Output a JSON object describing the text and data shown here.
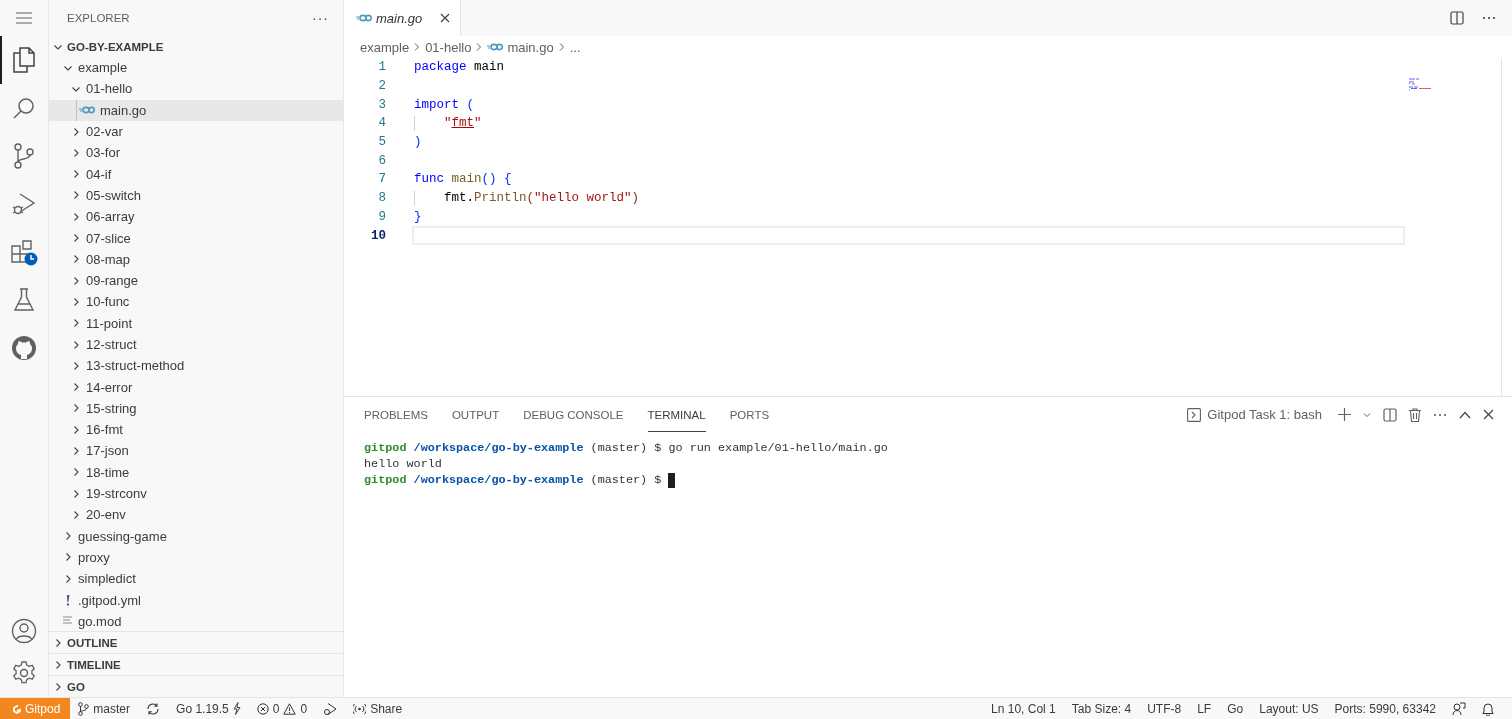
{
  "activity_bar": {
    "top": [
      {
        "kind": "menu",
        "selected": false
      },
      {
        "kind": "explorer",
        "selected": true
      },
      {
        "kind": "search",
        "selected": false
      },
      {
        "kind": "source-control",
        "selected": false
      },
      {
        "kind": "run-debug",
        "selected": false
      },
      {
        "kind": "extensions",
        "selected": false
      },
      {
        "kind": "testing",
        "selected": false
      },
      {
        "kind": "github",
        "selected": false
      }
    ],
    "bottom": [
      {
        "kind": "account"
      },
      {
        "kind": "settings"
      }
    ]
  },
  "sidebar": {
    "title": "EXPLORER",
    "more": "···",
    "root": {
      "label": "GO-BY-EXAMPLE",
      "expanded": true,
      "children": [
        {
          "label": "example",
          "kind": "folder",
          "expanded": true,
          "selected": false,
          "children": [
            {
              "label": "01-hello",
              "kind": "folder",
              "expanded": true,
              "selected": false,
              "children": [
                {
                  "label": "main.go",
                  "kind": "go",
                  "selected": true
                }
              ]
            },
            {
              "label": "02-var",
              "kind": "folder",
              "expanded": false,
              "selected": false
            },
            {
              "label": "03-for",
              "kind": "folder",
              "expanded": false,
              "selected": false
            },
            {
              "label": "04-if",
              "kind": "folder",
              "expanded": false,
              "selected": false
            },
            {
              "label": "05-switch",
              "kind": "folder",
              "expanded": false,
              "selected": false
            },
            {
              "label": "06-array",
              "kind": "folder",
              "expanded": false,
              "selected": false
            },
            {
              "label": "07-slice",
              "kind": "folder",
              "expanded": false,
              "selected": false
            },
            {
              "label": "08-map",
              "kind": "folder",
              "expanded": false,
              "selected": false
            },
            {
              "label": "09-range",
              "kind": "folder",
              "expanded": false,
              "selected": false
            },
            {
              "label": "10-func",
              "kind": "folder",
              "expanded": false,
              "selected": false
            },
            {
              "label": "11-point",
              "kind": "folder",
              "expanded": false,
              "selected": false
            },
            {
              "label": "12-struct",
              "kind": "folder",
              "expanded": false,
              "selected": false
            },
            {
              "label": "13-struct-method",
              "kind": "folder",
              "expanded": false,
              "selected": false
            },
            {
              "label": "14-error",
              "kind": "folder",
              "expanded": false,
              "selected": false
            },
            {
              "label": "15-string",
              "kind": "folder",
              "expanded": false,
              "selected": false
            },
            {
              "label": "16-fmt",
              "kind": "folder",
              "expanded": false,
              "selected": false
            },
            {
              "label": "17-json",
              "kind": "folder",
              "expanded": false,
              "selected": false
            },
            {
              "label": "18-time",
              "kind": "folder",
              "expanded": false,
              "selected": false
            },
            {
              "label": "19-strconv",
              "kind": "folder",
              "expanded": false,
              "selected": false
            },
            {
              "label": "20-env",
              "kind": "folder",
              "expanded": false,
              "selected": false
            }
          ]
        },
        {
          "label": "guessing-game",
          "kind": "folder",
          "expanded": false,
          "selected": false
        },
        {
          "label": "proxy",
          "kind": "folder",
          "expanded": false,
          "selected": false
        },
        {
          "label": "simpledict",
          "kind": "folder",
          "expanded": false,
          "selected": false
        },
        {
          "label": ".gitpod.yml",
          "kind": "yaml",
          "selected": false
        },
        {
          "label": "go.mod",
          "kind": "text",
          "selected": false
        }
      ]
    },
    "sections": [
      {
        "label": "OUTLINE",
        "expanded": false
      },
      {
        "label": "TIMELINE",
        "expanded": false
      },
      {
        "label": "GO",
        "expanded": false
      }
    ]
  },
  "editor": {
    "tabs": [
      {
        "label": "main.go",
        "preview": true,
        "selected": true
      }
    ],
    "breadcrumb": [
      "example",
      "01-hello",
      "main.go",
      "..."
    ],
    "lines": [
      {
        "number": "1",
        "current": false,
        "indented": false,
        "tokens": [
          {
            "text": "package",
            "kind": "keyword"
          },
          {
            "text": " main",
            "kind": "plain"
          }
        ]
      },
      {
        "number": "2",
        "current": false,
        "indented": false
      },
      {
        "number": "3",
        "current": false,
        "indented": false,
        "tokens": [
          {
            "text": "import",
            "kind": "keyword"
          },
          {
            "text": " (",
            "kind": "bracket1"
          }
        ]
      },
      {
        "number": "4",
        "current": false,
        "indented": true,
        "tokens": [
          {
            "text": "\"",
            "kind": "string",
            "underline": false
          },
          {
            "text": "fmt",
            "kind": "string",
            "underline": true
          },
          {
            "text": "\"",
            "kind": "string",
            "underline": false
          }
        ]
      },
      {
        "number": "5",
        "current": false,
        "indented": false,
        "tokens": [
          {
            "text": ")",
            "kind": "bracket1"
          }
        ]
      },
      {
        "number": "6",
        "current": false,
        "indented": false
      },
      {
        "number": "7",
        "current": false,
        "indented": false,
        "tokens": [
          {
            "text": "func",
            "kind": "keyword"
          },
          {
            "text": " main",
            "kind": "function"
          },
          {
            "text": "() {",
            "kind": "bracket1"
          }
        ]
      },
      {
        "number": "8",
        "current": false,
        "indented": true,
        "tokens": [
          {
            "text": "fmt.",
            "kind": "plain"
          },
          {
            "text": "Println",
            "kind": "function"
          },
          {
            "text": "(",
            "kind": "bracket2"
          },
          {
            "text": "\"hello world\"",
            "kind": "string"
          },
          {
            "text": ")",
            "kind": "bracket2"
          }
        ]
      },
      {
        "number": "9",
        "current": false,
        "indented": false,
        "tokens": [
          {
            "text": "}",
            "kind": "bracket1"
          }
        ]
      },
      {
        "number": "10",
        "current": true,
        "indented": false
      }
    ]
  },
  "panel": {
    "tabs": [
      {
        "label": "PROBLEMS",
        "selected": false
      },
      {
        "label": "OUTPUT",
        "selected": false
      },
      {
        "label": "DEBUG CONSOLE",
        "selected": false
      },
      {
        "label": "TERMINAL",
        "selected": true
      },
      {
        "label": "PORTS",
        "selected": false
      }
    ],
    "terminal_name": "Gitpod Task 1: bash",
    "terminal": [
      {
        "cursor": false,
        "segments": [
          {
            "text": "gitpod",
            "kind": "user"
          },
          {
            "text": " /workspace/go-by-example",
            "kind": "path"
          },
          {
            "text": " (master) $ go run example/01-hello/main.go",
            "kind": "plain"
          }
        ]
      },
      {
        "cursor": false,
        "segments": [
          {
            "text": "hello world",
            "kind": "plain"
          }
        ]
      },
      {
        "cursor": true,
        "segments": [
          {
            "text": "gitpod",
            "kind": "user"
          },
          {
            "text": " /workspace/go-by-example",
            "kind": "path"
          },
          {
            "text": " (master) $",
            "kind": "plain"
          }
        ]
      }
    ]
  },
  "status_bar": {
    "left": [
      {
        "kind": "remote",
        "text": "Gitpod"
      },
      {
        "kind": "branch",
        "text": "master"
      },
      {
        "kind": "sync"
      },
      {
        "kind": "go-version",
        "text": "Go 1.19.5"
      },
      {
        "kind": "problems",
        "errors": "0",
        "warnings": "0"
      },
      {
        "kind": "debug"
      },
      {
        "kind": "share",
        "text": "Share"
      }
    ],
    "right": [
      {
        "kind": "text",
        "text": "Ln 10, Col 1"
      },
      {
        "kind": "text",
        "text": "Tab Size: 4"
      },
      {
        "kind": "text",
        "text": "UTF-8"
      },
      {
        "kind": "text",
        "text": "LF"
      },
      {
        "kind": "text",
        "text": "Go"
      },
      {
        "kind": "text",
        "text": "Layout: US"
      },
      {
        "kind": "text",
        "text": "Ports: 5990, 63342"
      },
      {
        "kind": "feedback"
      },
      {
        "kind": "bell"
      }
    ]
  }
}
